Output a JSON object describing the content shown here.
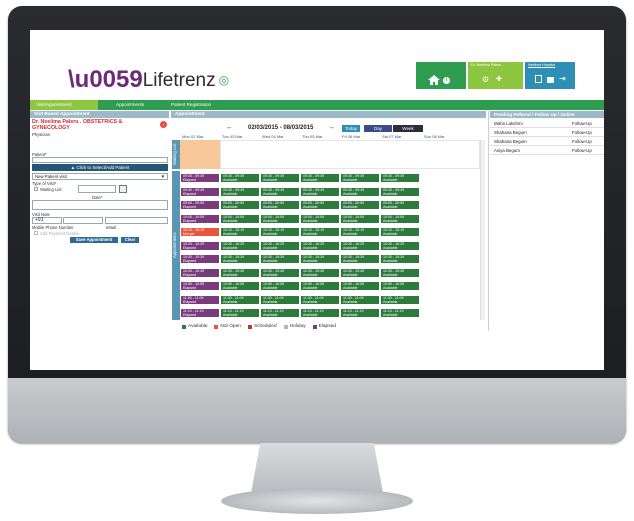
{
  "brand": {
    "logo_text": "Lifetrenz"
  },
  "header": {
    "user_label": "Dr. Neelima Paleru",
    "hospital_label": "Neelima Hospital",
    "home_icon": "home-icon",
    "info_icon": "info-icon",
    "settings_icon": "gear-icon",
    "add_user_icon": "add-user-icon",
    "document_icon": "document-icon",
    "lock_icon": "lock-icon",
    "logout_icon": "logout-icon"
  },
  "nav": {
    "tabs": [
      "Visit/Appointment",
      "Appointments",
      "Patient Registration"
    ]
  },
  "left": {
    "title": "Slot Based Appointment",
    "doctor": "Dr. Neelima Paleru . OBSTETRICS & GYNECOLOGY",
    "role": "Physician",
    "patient_label": "Patient*",
    "select_button": "▲ Click to Select/Add Patient",
    "visit_select": "New Patient visit",
    "type_of_visit_label": "Type of Visit*",
    "waiting_list_label": "Waiting List",
    "date_label": "Date*",
    "visit_note_label": "Visit Note",
    "country_code": "+91",
    "mobile_label": "Mobile Phone Number",
    "email_label": "eMail",
    "add_payment_label": "Add Payment Details",
    "save_button": "Save Appointment",
    "clear_button": "Clear"
  },
  "main": {
    "title": "Appointment",
    "date_range": "02/03/2015 - 08/03/2015",
    "today_button": "Today",
    "day_button": "Day",
    "week_button": "Week",
    "days": [
      "Mon 02 Mar",
      "Tue 03 Mar",
      "Wed 04 Mar",
      "Thu 05 Mar",
      "Fri 06 Mar",
      "Sat 07 Mar",
      "Sun 08 Mar"
    ],
    "waiting_list_tab": "Waiting List",
    "appointments_tab": "Appointments",
    "times": [
      "09:30 - 09:39",
      "09:40 - 09:49",
      "09:50 - 09:59",
      "10:00 - 10:09",
      "10:10 - 10:19",
      "10:20 - 10:29",
      "10:30 - 10:39",
      "10:40 - 10:49",
      "10:50 - 10:59",
      "11:00 - 11:09",
      "11:10 - 11:19"
    ],
    "mon_status": [
      "Elapsed",
      "Elapsed",
      "Elapsed",
      "Elapsed",
      "Not yet",
      "Elapsed",
      "Elapsed",
      "Elapsed",
      "Elapsed",
      "Elapsed",
      "Elapsed"
    ],
    "available_text": "Available"
  },
  "legend": [
    {
      "label": "Available",
      "color": "#2c7a3c"
    },
    {
      "label": "Not Open",
      "color": "#e9563f"
    },
    {
      "label": "Scheduled",
      "color": "#c0392b"
    },
    {
      "label": "Holiday",
      "color": "#b7b7b7"
    },
    {
      "label": "Elapsed",
      "color": "#7a3b7d"
    }
  ],
  "right": {
    "title": "Pending Referral / Follow Up / Online",
    "items": [
      {
        "name": "Maha Lakshmi",
        "type": "Follow-Up"
      },
      {
        "name": "Shahana Begum",
        "type": "Follow-Up"
      },
      {
        "name": "Shahana Begum",
        "type": "Follow-Up"
      },
      {
        "name": "Asiya Begum",
        "type": "Follow-Up"
      }
    ]
  }
}
